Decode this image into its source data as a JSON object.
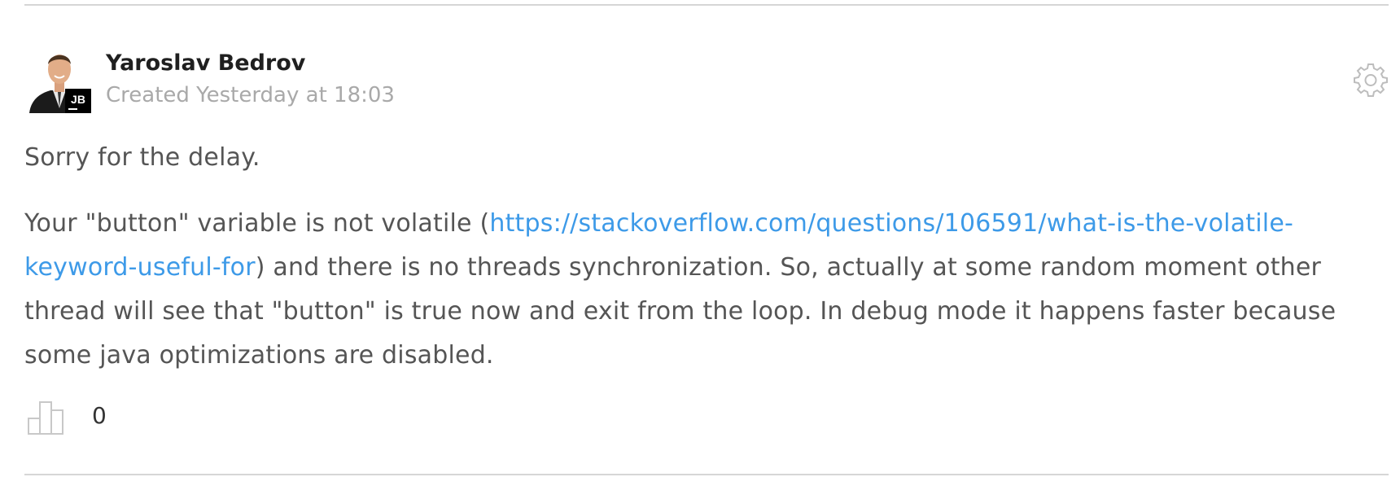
{
  "author": {
    "name": "Yaroslav Bedrov",
    "badge": "JB",
    "created": "Created Yesterday at 18:03"
  },
  "comment": {
    "paragraph1": "Sorry for the delay.",
    "paragraph2_before": "Your \"button\" variable is not  volatile (",
    "link_text": "https://stackoverflow.com/questions/106591/what-is-the-volatile-keyword-useful-for",
    "link_url": "https://stackoverflow.com/questions/106591/what-is-the-volatile-keyword-useful-for",
    "paragraph2_after": ") and there is no threads synchronization. So, actually at some random moment other thread will see that \"button\" is true now and exit from the loop. In debug mode it happens faster because some java optimizations are disabled."
  },
  "votes": {
    "count": "0",
    "icon": "vote-bars-icon"
  },
  "settings": {
    "icon": "gear-icon"
  },
  "colors": {
    "link": "#3d9ae8",
    "body_text": "#555555",
    "meta_text": "#a9a9a9",
    "divider": "#d6d6d6"
  }
}
